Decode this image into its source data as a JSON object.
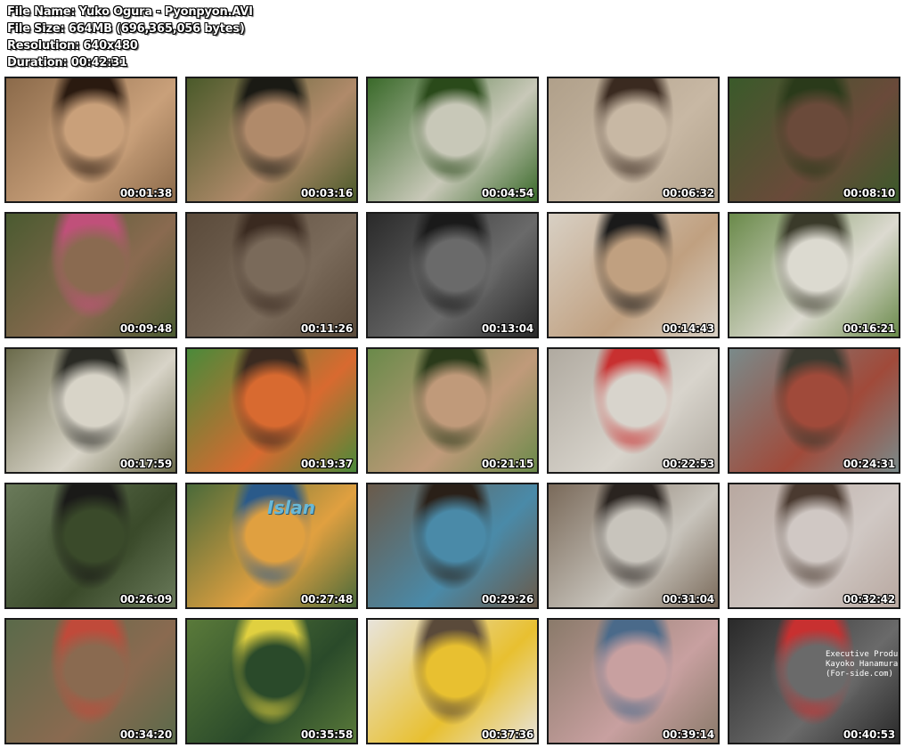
{
  "header": {
    "file_name": "File Name: Yuko Ogura - Pyonpyon.AVI",
    "file_size": "File Size: 664MB (696,365,056 bytes)",
    "resolution": "Resolution: 640x480",
    "duration": "Duration: 00:42:31"
  },
  "thumbnails": [
    {
      "time": "00:01:38",
      "colors": [
        "#8b6a4a",
        "#c9a07a",
        "#2a1a10"
      ]
    },
    {
      "time": "00:03:16",
      "colors": [
        "#4a5a2a",
        "#b08a6a",
        "#1a1a14"
      ]
    },
    {
      "time": "00:04:54",
      "colors": [
        "#3a6a2a",
        "#c8c8b8",
        "#2a4a1a"
      ]
    },
    {
      "time": "00:06:32",
      "colors": [
        "#b0a08a",
        "#c8b8a4",
        "#3a2a20"
      ]
    },
    {
      "time": "00:08:10",
      "colors": [
        "#3a5a2a",
        "#6a4a3a",
        "#2a3a1a"
      ]
    },
    {
      "time": "00:09:48",
      "colors": [
        "#4a5a30",
        "#8a6a50",
        "#c0507a"
      ]
    },
    {
      "time": "00:11:26",
      "colors": [
        "#5a4a3a",
        "#7a6a5a",
        "#3a2a20"
      ]
    },
    {
      "time": "00:13:04",
      "colors": [
        "#2a2a2a",
        "#6a6a6a",
        "#1a1a1a"
      ]
    },
    {
      "time": "00:14:43",
      "colors": [
        "#d8d0c4",
        "#c0a080",
        "#1a1a1a"
      ]
    },
    {
      "time": "00:16:21",
      "colors": [
        "#6a8a4a",
        "#dcdad0",
        "#3a3a2a"
      ]
    },
    {
      "time": "00:17:59",
      "colors": [
        "#6a6a4a",
        "#d8d4c8",
        "#2a2a24"
      ]
    },
    {
      "time": "00:19:37",
      "colors": [
        "#4a8a3a",
        "#d86a30",
        "#3a2a20"
      ]
    },
    {
      "time": "00:21:15",
      "colors": [
        "#6a8a4a",
        "#c09a7a",
        "#2a3a1a"
      ]
    },
    {
      "time": "00:22:53",
      "colors": [
        "#b0aaa0",
        "#d8d4cc",
        "#c83030"
      ]
    },
    {
      "time": "00:24:31",
      "colors": [
        "#7a8a8a",
        "#a04a3a",
        "#3a3a30"
      ]
    },
    {
      "time": "00:26:09",
      "colors": [
        "#6a7a5a",
        "#3a4a2a",
        "#1a1a18"
      ]
    },
    {
      "time": "00:27:48",
      "colors": [
        "#4a6a3a",
        "#e0a040",
        "#2a5a8a"
      ],
      "label": "Islan"
    },
    {
      "time": "00:29:26",
      "colors": [
        "#6a5a4a",
        "#4a8aa8",
        "#2a2018"
      ]
    },
    {
      "time": "00:31:04",
      "colors": [
        "#7a6a5a",
        "#c8c4bc",
        "#2a2420"
      ]
    },
    {
      "time": "00:32:42",
      "colors": [
        "#b8a8a0",
        "#d0c8c4",
        "#4a3a30"
      ]
    },
    {
      "time": "00:34:20",
      "colors": [
        "#5a6a4a",
        "#8a6a50",
        "#c04a3a"
      ]
    },
    {
      "time": "00:35:58",
      "colors": [
        "#5a7a3a",
        "#2a4a2a",
        "#e0d040"
      ]
    },
    {
      "time": "00:37:36",
      "colors": [
        "#e8e4dc",
        "#e8c030",
        "#5a4a3a"
      ]
    },
    {
      "time": "00:39:14",
      "colors": [
        "#8a7a6a",
        "#c8a0a0",
        "#4a6a8a"
      ]
    },
    {
      "time": "00:40:53",
      "colors": [
        "#2a2a2a",
        "#6a6a6a",
        "#c83030"
      ],
      "credit": "Executive Producer\nKayoko Hanamura\n(For-side.com)"
    }
  ]
}
